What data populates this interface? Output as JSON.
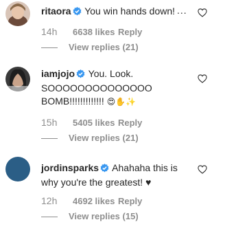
{
  "comments": [
    {
      "username": "ritaora",
      "text": "You win hands down!",
      "emoji": "",
      "time": "14h",
      "likes": "6638 likes",
      "reply": "Reply",
      "view_replies": "View replies (21)"
    },
    {
      "username": "iamjojo",
      "text": "You. Look. SOOOOOOOOOOOOOO BOMB!!!!!!!!!!!!!",
      "emoji": "😍✋✨",
      "time": "15h",
      "likes": "5405 likes",
      "reply": "Reply",
      "view_replies": "View replies (21)"
    },
    {
      "username": "jordinsparks",
      "text": "Ahahaha this is why you're the greatest! ♥",
      "emoji": "",
      "time": "12h",
      "likes": "4692 likes",
      "reply": "Reply",
      "view_replies": "View replies (15)"
    }
  ],
  "more_options_label": "...",
  "colors": {
    "verified": "#3897f0",
    "muted": "#8e8e8e",
    "text": "#262626",
    "avatar_jordin": "#2b5e86"
  },
  "icons": {
    "verified": "verified-badge-icon",
    "like": "heart-outline-icon",
    "more": "more-options-icon"
  }
}
